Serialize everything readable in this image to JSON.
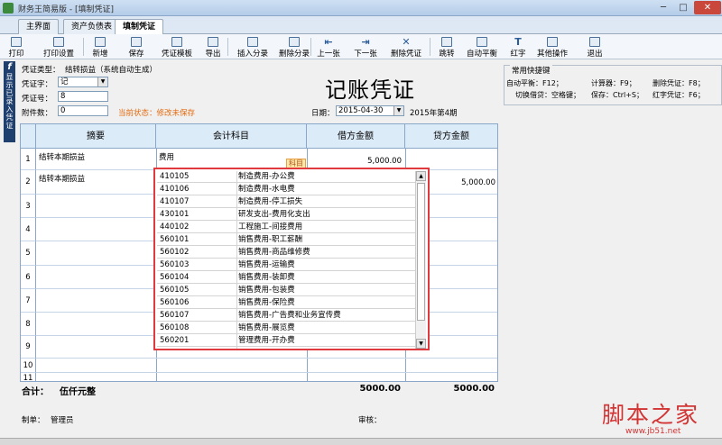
{
  "window": {
    "title": "财务王简易版 - [填制凭证]",
    "minimize": "─",
    "maximize": "□",
    "close": "✕"
  },
  "tabs": [
    {
      "label": "主界面"
    },
    {
      "label": "资产负债表"
    },
    {
      "label": "填制凭证",
      "active": true
    }
  ],
  "toolbar": [
    {
      "label": "打印",
      "icon": "printer-icon"
    },
    {
      "label": "打印设置",
      "icon": "print-settings-icon"
    },
    {
      "label": "新增",
      "icon": "new-doc-icon"
    },
    {
      "label": "保存",
      "icon": "save-icon"
    },
    {
      "label": "凭证模板",
      "icon": "template-icon"
    },
    {
      "label": "导出",
      "icon": "export-icon"
    },
    {
      "label": "插入分录",
      "icon": "insert-entry-icon"
    },
    {
      "label": "删除分录",
      "icon": "delete-entry-icon"
    },
    {
      "label": "上一张",
      "icon": "prev-arrow-icon",
      "glyph": "⇤"
    },
    {
      "label": "下一张",
      "icon": "next-arrow-icon",
      "glyph": "⇥"
    },
    {
      "label": "删除凭证",
      "icon": "delete-voucher-icon",
      "glyph": "✕"
    },
    {
      "label": "跳转",
      "icon": "jump-icon"
    },
    {
      "label": "自动平衡",
      "icon": "auto-balance-icon"
    },
    {
      "label": "红字",
      "icon": "red-text-icon",
      "glyph": "T"
    },
    {
      "label": "其他操作",
      "icon": "other-actions-icon"
    },
    {
      "label": "退出",
      "icon": "exit-icon"
    }
  ],
  "sidebar": {
    "icon_letter": "f",
    "text": "显示已录入凭证"
  },
  "form": {
    "voucher_type_label": "凭证类型：",
    "voucher_type_value": "结转损益（系统自动生成）",
    "voucher_word_label": "凭证字：",
    "voucher_word_value": "记",
    "voucher_no_label": "凭证号：",
    "voucher_no_value": "8",
    "attachments_label": "附件数：",
    "attachments_value": "0",
    "status": "当前状态：修改未保存",
    "title": "记账凭证",
    "date_label": "日期：",
    "date_value": "2015-04-30",
    "period": "2015年第4期"
  },
  "hotkeys": {
    "title": "常用快捷键",
    "items": [
      "自动平衡：F12；",
      "计算器：F9；",
      "删除凭证：F8；",
      "切换借贷：空格键；",
      "保存：Ctrl+S；",
      "红字凭证：F6；"
    ]
  },
  "grid": {
    "headers": [
      "摘要",
      "会计科目",
      "借方金额",
      "贷方金额"
    ],
    "row_numbers": [
      "1",
      "2",
      "3",
      "4",
      "5",
      "6",
      "7",
      "8",
      "9",
      "10",
      "11"
    ],
    "rows": [
      {
        "summary": "结转本期损益",
        "account": "费用",
        "debit": "5,000.00",
        "credit": ""
      },
      {
        "summary": "结转本期损益",
        "account": "",
        "debit": "",
        "credit": "5,000.00"
      }
    ],
    "account_chip": "科目"
  },
  "account_popup": [
    {
      "code": "410105",
      "name": "制造费用-办公费"
    },
    {
      "code": "410106",
      "name": "制造费用-水电费"
    },
    {
      "code": "410107",
      "name": "制造费用-停工损失"
    },
    {
      "code": "430101",
      "name": "研发支出-费用化支出"
    },
    {
      "code": "440102",
      "name": "工程施工-间接费用"
    },
    {
      "code": "560101",
      "name": "销售费用-职工薪酬"
    },
    {
      "code": "560102",
      "name": "销售费用-商品维修费"
    },
    {
      "code": "560103",
      "name": "销售费用-运输费"
    },
    {
      "code": "560104",
      "name": "销售费用-装卸费"
    },
    {
      "code": "560105",
      "name": "销售费用-包装费"
    },
    {
      "code": "560106",
      "name": "销售费用-保险费"
    },
    {
      "code": "560107",
      "name": "销售费用-广告费和业务宣传费"
    },
    {
      "code": "560108",
      "name": "销售费用-展览费"
    },
    {
      "code": "560201",
      "name": "管理费用-开办费"
    }
  ],
  "totals": {
    "label": "合计：",
    "amount_text": "伍仟元整",
    "debit": "5000.00",
    "credit": "5000.00"
  },
  "footer": {
    "maker_label": "制单：",
    "maker_value": "管理员",
    "audit_label": "审核："
  },
  "watermark": {
    "text": "脚本之家",
    "url": "www.jb51.net"
  },
  "colors": {
    "popup_border": "#e0393e",
    "status_text": "#e46b10",
    "header_bg": "#dcebf8"
  }
}
